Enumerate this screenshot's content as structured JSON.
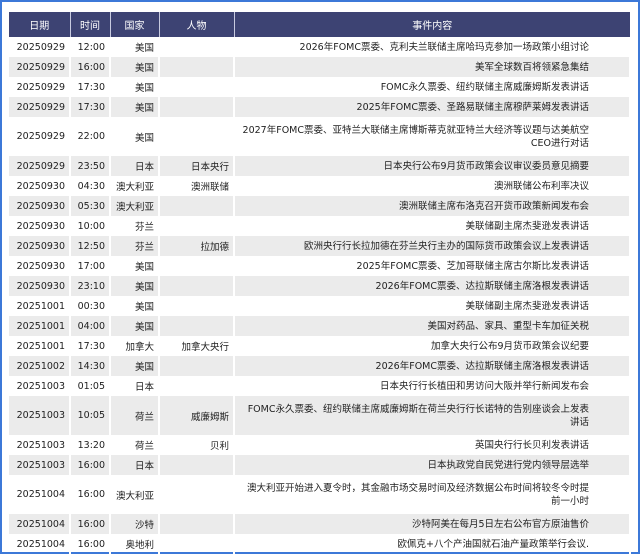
{
  "headers": [
    "日期",
    "时间",
    "国家",
    "人物",
    "事件内容"
  ],
  "rows": [
    [
      "20250929",
      "12:00",
      "美国",
      "",
      "2026年FOMC票委、克利夫兰联储主席哈玛克参加一场政策小组讨论"
    ],
    [
      "20250929",
      "16:00",
      "美国",
      "",
      "美军全球数百将领紧急集结"
    ],
    [
      "20250929",
      "17:30",
      "美国",
      "",
      "FOMC永久票委、纽约联储主席威廉姆斯发表讲话"
    ],
    [
      "20250929",
      "17:30",
      "美国",
      "",
      "2025年FOMC票委、圣路易联储主席穆萨莱姆发表讲话"
    ],
    [
      "20250929",
      "22:00",
      "美国",
      "",
      "2027年FOMC票委、亚特兰大联储主席博斯蒂克就亚特兰大经济等议题与达美航空CEO进行对话"
    ],
    [
      "20250929",
      "23:50",
      "日本",
      "日本央行",
      "日本央行公布9月货币政策会议审议委员意见摘要"
    ],
    [
      "20250930",
      "04:30",
      "澳大利亚",
      "澳洲联储",
      "澳洲联储公布利率决议"
    ],
    [
      "20250930",
      "05:30",
      "澳大利亚",
      "",
      "澳洲联储主席布洛克召开货币政策新闻发布会"
    ],
    [
      "20250930",
      "10:00",
      "芬兰",
      "",
      "美联储副主席杰斐逊发表讲话"
    ],
    [
      "20250930",
      "12:50",
      "芬兰",
      "拉加德",
      "欧洲央行行长拉加德在芬兰央行主办的国际货币政策会议上发表讲话"
    ],
    [
      "20250930",
      "17:00",
      "美国",
      "",
      "2025年FOMC票委、芝加哥联储主席古尔斯比发表讲话"
    ],
    [
      "20250930",
      "23:10",
      "美国",
      "",
      "2026年FOMC票委、达拉斯联储主席洛根发表讲话"
    ],
    [
      "20251001",
      "00:30",
      "美国",
      "",
      "美联储副主席杰斐逊发表讲话"
    ],
    [
      "20251001",
      "04:00",
      "美国",
      "",
      "美国对药品、家具、重型卡车加征关税"
    ],
    [
      "20251001",
      "17:30",
      "加拿大",
      "加拿大央行",
      "加拿大央行公布9月货币政策会议纪要"
    ],
    [
      "20251002",
      "14:30",
      "美国",
      "",
      "2026年FOMC票委、达拉斯联储主席洛根发表讲话"
    ],
    [
      "20251003",
      "01:05",
      "日本",
      "",
      "日本央行行长植田和男访问大阪并举行新闻发布会"
    ],
    [
      "20251003",
      "10:05",
      "荷兰",
      "威廉姆斯",
      "FOMC永久票委、纽约联储主席威廉姆斯在荷兰央行行长诺特的告别座谈会上发表讲话"
    ],
    [
      "20251003",
      "13:20",
      "荷兰",
      "贝利",
      "英国央行行长贝利发表讲话"
    ],
    [
      "20251003",
      "16:00",
      "日本",
      "",
      "日本执政党自民党进行党内领导层选举"
    ],
    [
      "20251004",
      "16:00",
      "澳大利亚",
      "",
      "澳大利亚开始进入夏令时，其金融市场交易时间及经济数据公布时间将较冬令时提前一小时"
    ],
    [
      "20251004",
      "16:00",
      "沙特",
      "",
      "沙特阿美在每月5日左右公布官方原油售价"
    ],
    [
      "20251004",
      "16:00",
      "奥地利",
      "",
      "欧佩克+八个产油国就石油产量政策举行会议."
    ]
  ],
  "colors": {
    "header_bg": "#3d4373",
    "stripe": "#ebebeb",
    "frame": "#3c78d8"
  }
}
